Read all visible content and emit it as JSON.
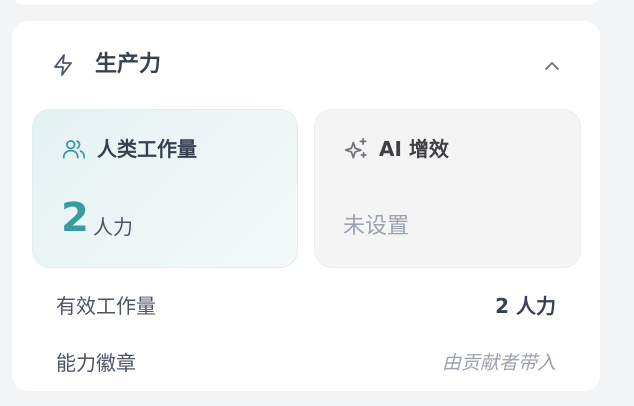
{
  "section": {
    "title": "生产力",
    "icon": "lightning-icon",
    "collapse_icon": "chevron-up-icon"
  },
  "cards": {
    "human": {
      "title": "人类工作量",
      "icon": "users-icon",
      "value": "2",
      "unit": "人力"
    },
    "ai": {
      "title": "AI 增效",
      "icon": "sparkles-icon",
      "status": "未设置"
    }
  },
  "details": {
    "effective_workload": {
      "label": "有效工作量",
      "value": "2 人力"
    },
    "ability_badge": {
      "label": "能力徽章",
      "placeholder": "由贡献者带入"
    }
  },
  "colors": {
    "accent": "#3a9b9e",
    "text_primary": "#374151",
    "text_muted": "#9ca3af"
  }
}
